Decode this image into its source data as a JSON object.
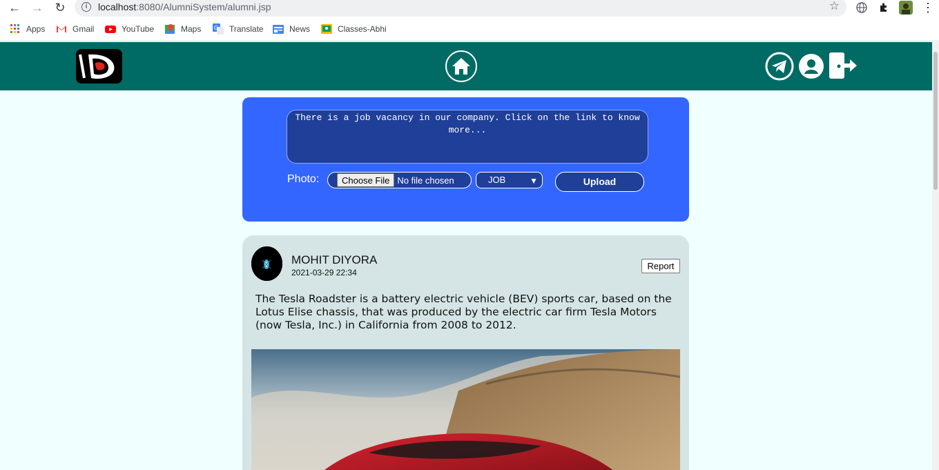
{
  "browser": {
    "url_host": "localhost",
    "url_rest": ":8080/AlumniSystem/alumni.jsp",
    "bookmarks": [
      {
        "label": "Apps",
        "color": "#4285f4"
      },
      {
        "label": "Gmail",
        "color": "#ea4335"
      },
      {
        "label": "YouTube",
        "color": "#ff0000"
      },
      {
        "label": "Maps",
        "color": "#34a853"
      },
      {
        "label": "Translate",
        "color": "#4285f4"
      },
      {
        "label": "News",
        "color": "#4285f4"
      },
      {
        "label": "Classes-Abhi",
        "color": "#f4b400"
      }
    ]
  },
  "header": {
    "brand_color": "#006b65",
    "icons": [
      "logo",
      "home-icon",
      "telegram-icon",
      "profile-icon",
      "logout-icon"
    ]
  },
  "composer": {
    "text": "There is a job vacancy in our company. Click on the link to know more...",
    "photo_label": "Photo:",
    "choose_file_label": "Choose File",
    "no_file_label": "No file chosen",
    "type_selected": "JOB",
    "upload_label": "Upload"
  },
  "post": {
    "author": "MOHIT DIYORA",
    "timestamp": "2021-03-29 22:34",
    "report_label": "Report",
    "body": "The Tesla Roadster is a battery electric vehicle (BEV) sports car, based on the Lotus Elise chassis, that was produced by the electric car firm Tesla Motors (now Tesla, Inc.) in California from 2008 to 2012."
  },
  "colors": {
    "page_bg": "#f0ffff",
    "composer_bg": "#3366ff",
    "post_bg": "#d5e5e5"
  }
}
